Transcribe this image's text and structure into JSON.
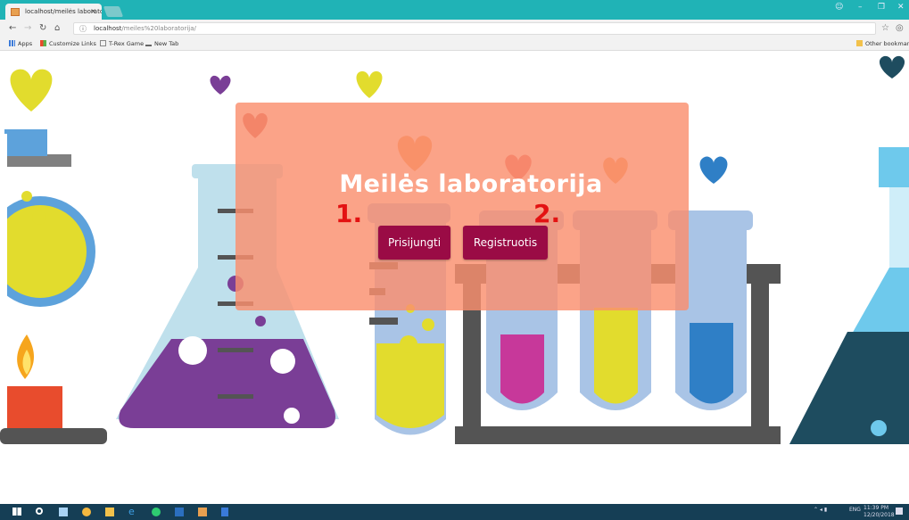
{
  "browser": {
    "tab_title": "localhost/meilės laboratorija/",
    "tab_close": "×",
    "url_host": "localhost",
    "url_path": "/meiles%20laboratorija/",
    "bookmarks": [
      "Apps",
      "Customize Links",
      "T-Rex Game",
      "New Tab"
    ],
    "other_bookmarks": "Other bookmarks"
  },
  "page": {
    "title": "Meilės laboratorija",
    "login_button": "Prisijungti",
    "register_button": "Registruotis",
    "marker_1": "1.",
    "marker_2": "2."
  },
  "taskbar": {
    "language": "ENG",
    "time": "11:39 PM",
    "date": "12/20/2018"
  },
  "colors": {
    "overlay": "#fa8f6e",
    "button": "#9a0b45",
    "marker": "#e31212",
    "tabbar": "#20b3b6",
    "taskbar": "#153e55"
  }
}
